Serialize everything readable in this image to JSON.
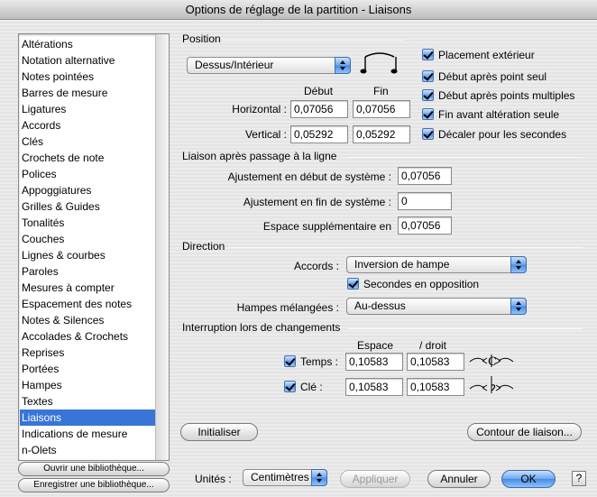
{
  "window": {
    "title": "Options de réglage de la partition - Liaisons"
  },
  "sidebar": {
    "items": [
      "Altérations",
      "Notation alternative",
      "Notes pointées",
      "Barres de mesure",
      "Ligatures",
      "Accords",
      "Clés",
      "Crochets de note",
      "Polices",
      "Appoggiatures",
      "Grilles & Guides",
      "Tonalités",
      "Couches",
      "Lignes & courbes",
      "Paroles",
      "Mesures à compter",
      "Espacement des notes",
      "Notes & Silences",
      "Accolades & Crochets",
      "Reprises",
      "Portées",
      "Hampes",
      "Textes",
      "Liaisons",
      "Indications de mesure",
      "n-Olets"
    ],
    "selected": "Liaisons",
    "open_library": "Ouvrir une bibliothèque...",
    "save_library": "Enregistrer une bibliothèque..."
  },
  "position": {
    "title": "Position",
    "placement_popup": "Dessus/Intérieur",
    "col_start": "Début",
    "col_end": "Fin",
    "horizontal_label": "Horizontal :",
    "vertical_label": "Vertical :",
    "horizontal_start": "0,07056",
    "horizontal_end": "0,07056",
    "vertical_start": "0,05292",
    "vertical_end": "0,05292",
    "options": [
      "Placement extérieur",
      "Début après point seul",
      "Début après points multiples",
      "Fin avant altération seule",
      "Décaler pour les secondes"
    ]
  },
  "line_break": {
    "title": "Liaison après passage à la ligne",
    "start_label": "Ajustement en début de système :",
    "start_value": "0,07056",
    "end_label": "Ajustement en fin de système :",
    "end_value": "0",
    "extra_label": "Espace supplémentaire en",
    "extra_value": "0,07056"
  },
  "direction": {
    "title": "Direction",
    "chords_label": "Accords :",
    "chords_value": "Inversion de hampe",
    "seconds_label": "Secondes en opposition",
    "mixed_label": "Hampes mélangées :",
    "mixed_value": "Au-dessus"
  },
  "interruption": {
    "title": "Interruption lors de changements",
    "col_space": "Espace",
    "col_right": "/ droit",
    "tempo_label": "Temps :",
    "tempo_space": "0,10583",
    "tempo_right": "0,10583",
    "clef_label": "Clé :",
    "clef_space": "0,10583",
    "clef_right": "0,10583"
  },
  "buttons": {
    "reset": "Initialiser",
    "contour": "Contour de liaison...",
    "units_label": "Unités :",
    "units_value": "Centimètres",
    "apply": "Appliquer",
    "cancel": "Annuler",
    "ok": "OK",
    "help": "?"
  },
  "colors": {
    "selection": "#3875d7",
    "aqua": "#4b8ae3"
  },
  "icons": [
    "slur-preview-icon",
    "tempo-slur-icon",
    "clef-slur-icon",
    "popup-arrow-icon",
    "checkmark-icon"
  ]
}
